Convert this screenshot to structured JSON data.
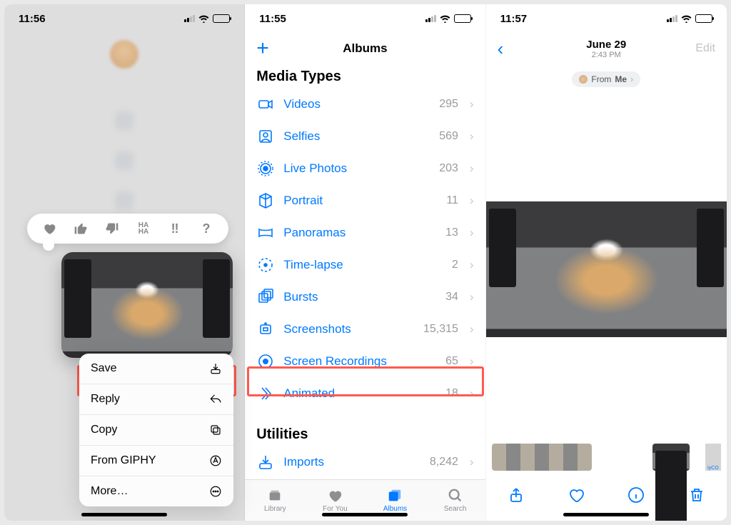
{
  "screen1": {
    "time": "11:56",
    "tapbacks": [
      "heart",
      "thumbs-up",
      "thumbs-down",
      "haha",
      "exclaim",
      "question"
    ],
    "actions": [
      {
        "label": "Save",
        "icon": "download-icon",
        "highlight": true
      },
      {
        "label": "Reply",
        "icon": "reply-icon"
      },
      {
        "label": "Copy",
        "icon": "copy-icon"
      },
      {
        "label": "From GIPHY",
        "icon": "appstore-icon"
      },
      {
        "label": "More…",
        "icon": "more-icon"
      }
    ]
  },
  "screen2": {
    "time": "11:55",
    "title": "Albums",
    "section1": "Media Types",
    "mediaTypes": [
      {
        "label": "Videos",
        "count": "295",
        "icon": "video-icon"
      },
      {
        "label": "Selfies",
        "count": "569",
        "icon": "selfie-icon"
      },
      {
        "label": "Live Photos",
        "count": "203",
        "icon": "live-icon"
      },
      {
        "label": "Portrait",
        "count": "11",
        "icon": "portrait-icon"
      },
      {
        "label": "Panoramas",
        "count": "13",
        "icon": "panorama-icon"
      },
      {
        "label": "Time-lapse",
        "count": "2",
        "icon": "timelapse-icon"
      },
      {
        "label": "Bursts",
        "count": "34",
        "icon": "burst-icon"
      },
      {
        "label": "Screenshots",
        "count": "15,315",
        "icon": "screenshot-icon"
      },
      {
        "label": "Screen Recordings",
        "count": "65",
        "icon": "screenrec-icon"
      },
      {
        "label": "Animated",
        "count": "18",
        "icon": "animated-icon",
        "highlight": true
      }
    ],
    "section2": "Utilities",
    "utilities": [
      {
        "label": "Imports",
        "count": "8,242",
        "icon": "import-icon"
      }
    ],
    "tabs": [
      {
        "label": "Library",
        "icon": "library-icon"
      },
      {
        "label": "For You",
        "icon": "foryou-icon"
      },
      {
        "label": "Albums",
        "icon": "albums-icon",
        "active": true
      },
      {
        "label": "Search",
        "icon": "search-icon"
      }
    ]
  },
  "screen3": {
    "time": "11:57",
    "date": "June 29",
    "subdate": "2:43 PM",
    "edit": "Edit",
    "fromLabel": "From",
    "fromName": "Me",
    "thumbLast": "iyCO",
    "toolbar": [
      "share-icon",
      "heart-outline-icon",
      "info-icon",
      "trash-icon"
    ]
  }
}
